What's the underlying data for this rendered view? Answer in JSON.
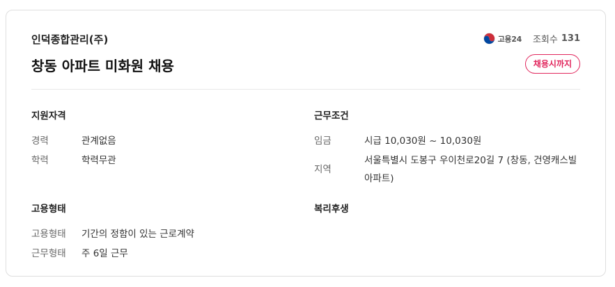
{
  "header": {
    "company": "인덕종합관리(주)",
    "title": "창동 아파트 미화원 채용",
    "source_label": "고용24",
    "views_label": "조회수",
    "views_count": "131",
    "deadline": "채용시까지"
  },
  "sections": {
    "qualification": {
      "title": "지원자격",
      "rows": [
        {
          "label": "경력",
          "value": "관계없음"
        },
        {
          "label": "학력",
          "value": "학력무관"
        }
      ]
    },
    "conditions": {
      "title": "근무조건",
      "rows": [
        {
          "label": "임금",
          "value": "시급 10,030원 ~ 10,030원"
        },
        {
          "label": "지역",
          "value": "서울특별시 도봉구 우이천로20길 7 (창동, 건영캐스빌 아파트)"
        }
      ]
    },
    "employment": {
      "title": "고용형태",
      "rows": [
        {
          "label": "고용형태",
          "value": "기간의 정함이 있는 근로계약"
        },
        {
          "label": "근무형태",
          "value": "주 6일 근무"
        }
      ]
    },
    "benefits": {
      "title": "복리후생"
    }
  },
  "colors": {
    "accent": "#e1245b",
    "border": "#dedede",
    "divider": "#e8e8e8",
    "logo_red": "#cd2e3a",
    "logo_blue": "#0047a0"
  },
  "icons": {
    "source_logo": "taegeuk-logo-icon"
  }
}
